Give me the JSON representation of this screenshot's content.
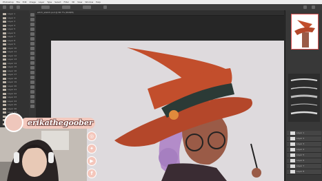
{
  "menubar": {
    "items": [
      "Photoshop",
      "File",
      "Edit",
      "Image",
      "Layer",
      "Type",
      "Select",
      "Filter",
      "3D",
      "View",
      "Window",
      "Help"
    ]
  },
  "document": {
    "tab_title": "witch_sketch.psd @ 66.7% (RGB/8)"
  },
  "stream": {
    "username": "erikathegoober",
    "social_icons": [
      "instagram-icon",
      "twitter-icon",
      "youtube-icon",
      "facebook-icon"
    ]
  },
  "colors": {
    "hat": "#c24e2c",
    "hat_band": "#2b3a36",
    "skin": "#9a5b47",
    "hair": "#b38cc9",
    "canvas": "#dedadd",
    "brand_pink": "#f3c9be"
  },
  "layers_left": [
    "Layer 1",
    "Layer 2",
    "Layer 3",
    "Layer 4",
    "Layer 5",
    "Layer 6",
    "Layer 7",
    "Layer 8",
    "Layer 9",
    "Layer 10",
    "Layer 11",
    "Layer 12",
    "Layer 13",
    "Layer 14",
    "Layer 15",
    "Layer 16",
    "Layer 17",
    "Layer 18",
    "Layer 19",
    "Layer 20",
    "Layer 21",
    "Layer 22",
    "Layer 23",
    "Layer 24",
    "Layer 25",
    "Layer 26",
    "Layer 27",
    "Layer 28",
    "Layer 29",
    "Layer 30"
  ],
  "layers_right": [
    "Layer 1",
    "Layer 2",
    "Layer 3",
    "Layer 4",
    "Layer 5",
    "Layer 6",
    "Layer 7",
    "Layer 8"
  ]
}
